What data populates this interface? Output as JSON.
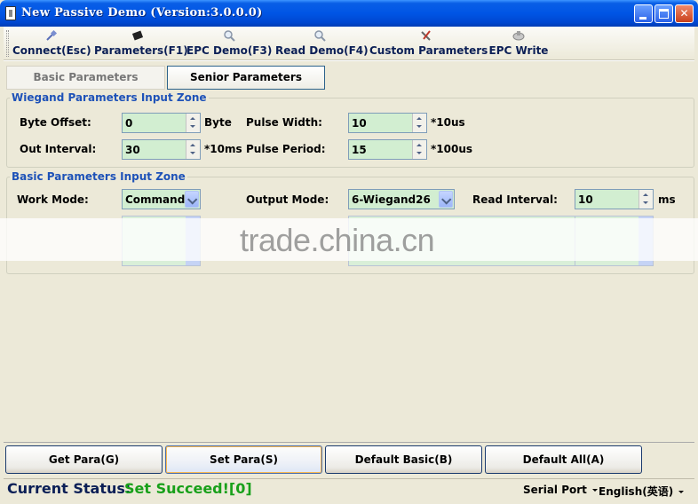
{
  "window": {
    "title": "New Passive Demo (Version:3.0.0.0)"
  },
  "toolbar": {
    "items": [
      {
        "label": "Connect(Esc)",
        "icon": "connect-plug-icon"
      },
      {
        "label": "Parameters(F1)",
        "icon": "chip-icon"
      },
      {
        "label": "EPC Demo(F3)",
        "icon": "magnifier-icon"
      },
      {
        "label": "Read Demo(F4)",
        "icon": "magnifier-icon"
      },
      {
        "label": "Custom Parameters",
        "icon": "tools-icon"
      },
      {
        "label": "EPC Write",
        "icon": "write-icon"
      }
    ]
  },
  "tabs": [
    {
      "label": "Basic Parameters"
    },
    {
      "label": "Senior Parameters"
    }
  ],
  "wiegand": {
    "title": "Wiegand Parameters Input Zone",
    "byte_offset": {
      "label": "Byte Offset:",
      "value": "0",
      "unit": "Byte"
    },
    "pulse_width": {
      "label": "Pulse Width:",
      "value": "10",
      "unit": "*10us"
    },
    "out_interval": {
      "label": "Out Interval:",
      "value": "30",
      "unit": "*10ms"
    },
    "pulse_period": {
      "label": "Pulse Period:",
      "value": "15",
      "unit": "*100us"
    }
  },
  "basic": {
    "title": "Basic Parameters Input Zone",
    "work_mode": {
      "label": "Work Mode:",
      "value": "Command"
    },
    "output_mode": {
      "label": "Output Mode:",
      "value": "6-Wiegand26"
    },
    "read_interval": {
      "label": "Read Interval:",
      "value": "10",
      "unit": "ms"
    }
  },
  "watermark": "trade.china.cn",
  "buttons": {
    "get_para": "Get Para(G)",
    "set_para": "Set Para(S)",
    "default_basic": "Default Basic(B)",
    "default_all": "Default All(A)"
  },
  "status": {
    "label": "Current Status:",
    "value": "Set Succeed![0]",
    "serial_port": "Serial Port",
    "language": "English(英语)"
  },
  "colors": {
    "title_bar": "#0055e5",
    "group_title": "#1e52b8",
    "input_bg": "#d2eed1",
    "status_ok": "#18a01a"
  }
}
